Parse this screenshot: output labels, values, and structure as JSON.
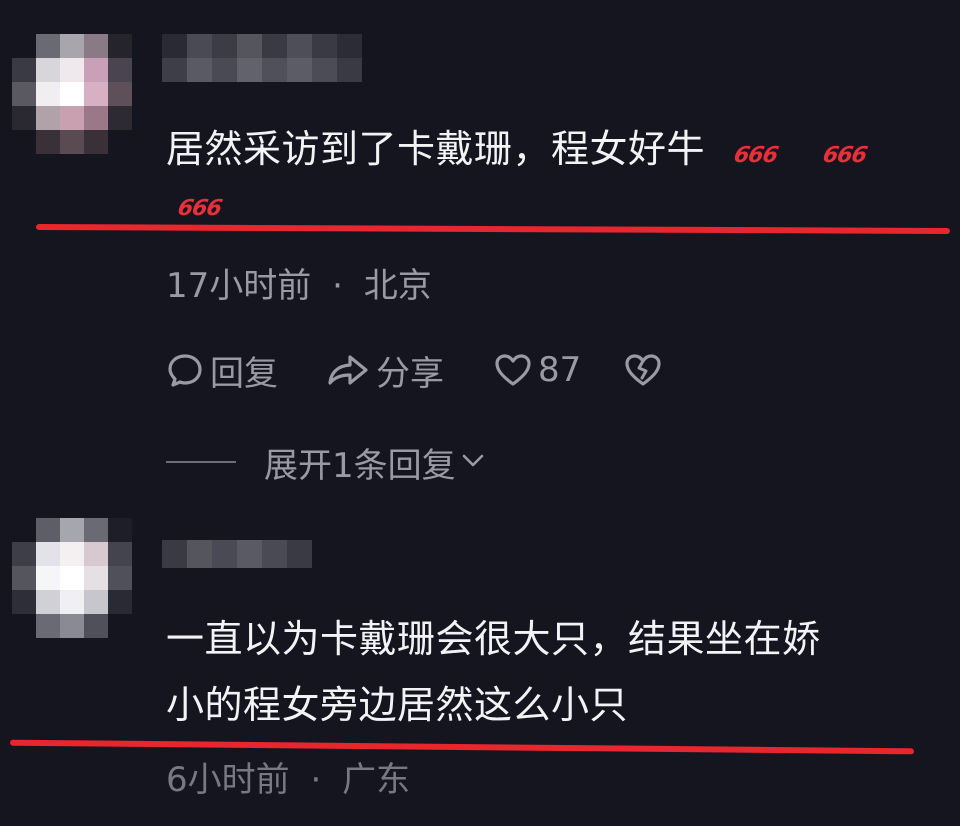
{
  "comments": [
    {
      "text": "居然采访到了卡戴珊，程女好牛",
      "emoji": [
        "666",
        "666",
        "666"
      ],
      "time": "17小时前",
      "location": "北京",
      "separator": "·",
      "actions": {
        "reply": "回复",
        "share": "分享",
        "likes": "87"
      },
      "expand_replies": "展开1条回复"
    },
    {
      "text_line1": "一直以为卡戴珊会很大只，结果坐在娇",
      "text_line2": "小的程女旁边居然这么小只",
      "time": "6小时前",
      "location": "广东",
      "separator": "·"
    }
  ],
  "colors": {
    "background": "#15151f",
    "text": "#f3f3f6",
    "meta": "#9a9aa6",
    "annotation_red": "#e8262e"
  },
  "icons": [
    "comment-bubble-icon",
    "share-arrow-icon",
    "heart-icon",
    "broken-heart-icon",
    "chevron-down-icon"
  ]
}
